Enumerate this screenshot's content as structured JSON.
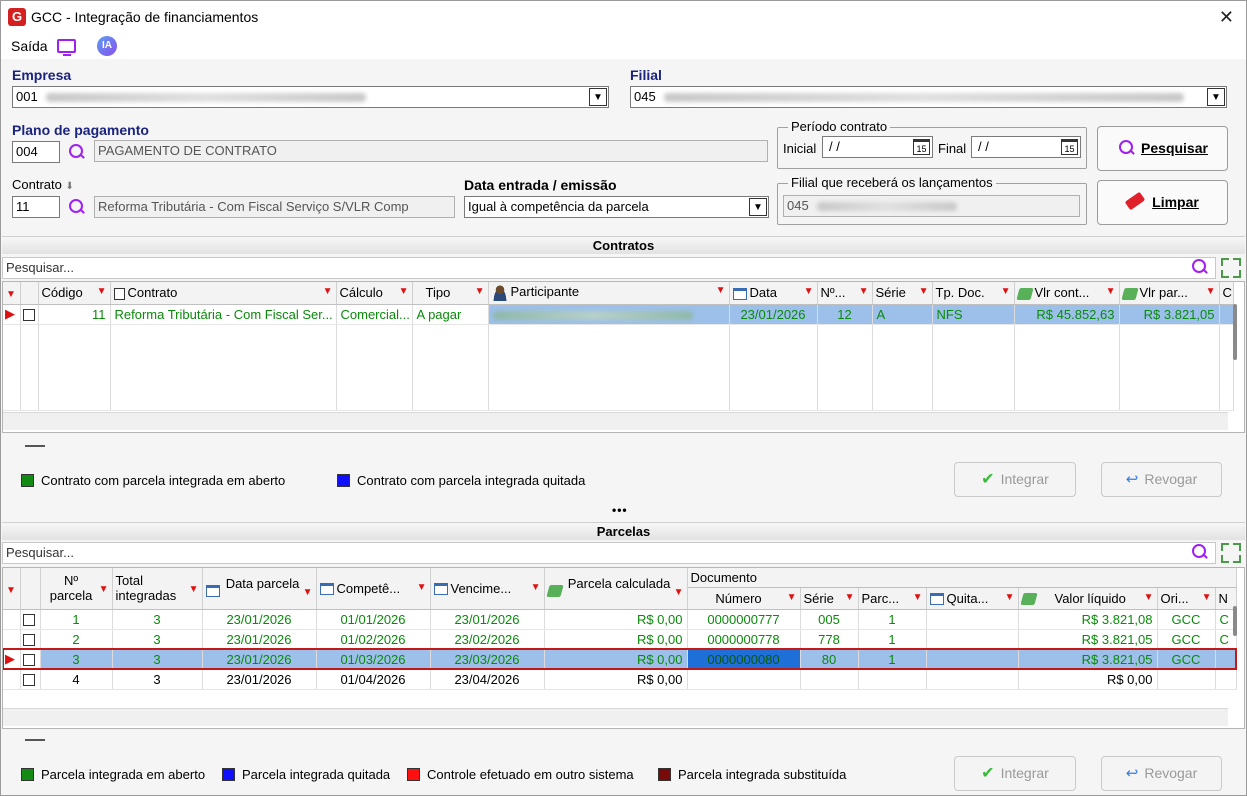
{
  "window": {
    "title": "GCC - Integração de financiamentos",
    "logo": "G",
    "close": "✕"
  },
  "menu": {
    "saida": "Saída",
    "ia": "IA"
  },
  "empresa": {
    "label": "Empresa",
    "code": "001"
  },
  "filial": {
    "label": "Filial",
    "code": "045"
  },
  "plano": {
    "label": "Plano de pagamento",
    "code": "004",
    "desc": "PAGAMENTO DE CONTRATO"
  },
  "periodo": {
    "label": "Período contrato",
    "inicial_label": "Inicial",
    "inicial_value": "/ /",
    "final_label": "Final",
    "final_value": "/ /",
    "cal": "15"
  },
  "contrato": {
    "label": "Contrato",
    "code": "11",
    "desc": "Reforma Tributária - Com Fiscal Serviço S/VLR Comp"
  },
  "data_entrada": {
    "label": "Data entrada / emissão",
    "value": "Igual à competência da parcela"
  },
  "filial_receb": {
    "label": "Filial que receberá os lançamentos",
    "code": "045"
  },
  "buttons": {
    "pesquisar": "Pesquisar",
    "limpar": "Limpar",
    "integrar": "Integrar",
    "revogar": "Revogar"
  },
  "contratos": {
    "title": "Contratos",
    "search_placeholder": "Pesquisar...",
    "headers": [
      "Código",
      "Contrato",
      "Cálculo",
      "Tipo",
      "Participante",
      "Data",
      "Nº...",
      "Série",
      "Tp. Doc.",
      "Vlr cont...",
      "Vlr par...",
      "C"
    ],
    "rows": [
      {
        "codigo": "11",
        "contrato": "Reforma Tributária - Com Fiscal Ser...",
        "calculo": "Comercial...",
        "tipo": "A pagar",
        "data": "23/01/2026",
        "num": "12",
        "serie": "A",
        "tpdoc": "NFS",
        "vlr_cont": "R$ 45.852,63",
        "vlr_par": "R$ 3.821,05"
      }
    ],
    "legend": [
      "Contrato com parcela integrada em aberto",
      "Contrato com parcela integrada quitada"
    ],
    "legend_colors": [
      "#138a13",
      "#1010ff"
    ]
  },
  "splitter": "•••",
  "parcelas": {
    "title": "Parcelas",
    "search_placeholder": "Pesquisar...",
    "headers": {
      "nparcela": "Nº parcela",
      "total": "Total integradas",
      "data": "Data parcela",
      "comp": "Competê...",
      "venc": "Vencime...",
      "calc": "Parcela calculada",
      "documento": "Documento",
      "numero": "Número",
      "serie": "Série",
      "parc": "Parc...",
      "quita": "Quita...",
      "valor": "Valor líquido",
      "ori": "Ori...",
      "n": "N"
    },
    "rows": [
      {
        "n": "1",
        "total": "3",
        "data": "23/01/2026",
        "comp": "01/01/2026",
        "venc": "23/01/2026",
        "calc": "R$ 0,00",
        "numero": "0000000777",
        "serie": "005",
        "parc": "1",
        "valor": "R$ 3.821,08",
        "ori": "GCC",
        "x": "C"
      },
      {
        "n": "2",
        "total": "3",
        "data": "23/01/2026",
        "comp": "01/02/2026",
        "venc": "23/02/2026",
        "calc": "R$ 0,00",
        "numero": "0000000778",
        "serie": "778",
        "parc": "1",
        "valor": "R$ 3.821,05",
        "ori": "GCC",
        "x": "C"
      },
      {
        "n": "3",
        "total": "3",
        "data": "23/01/2026",
        "comp": "01/03/2026",
        "venc": "23/03/2026",
        "calc": "R$ 0,00",
        "numero": "0000000080",
        "serie": "80",
        "parc": "1",
        "valor": "R$ 3.821,05",
        "ori": "GCC",
        "x": ""
      },
      {
        "n": "4",
        "total": "3",
        "data": "23/01/2026",
        "comp": "01/04/2026",
        "venc": "23/04/2026",
        "calc": "R$ 0,00",
        "numero": "",
        "serie": "",
        "parc": "",
        "valor": "R$ 0,00",
        "ori": "",
        "x": ""
      }
    ],
    "legend": [
      "Parcela integrada em aberto",
      "Parcela integrada quitada",
      "Controle efetuado em outro sistema",
      "Parcela integrada substituída"
    ],
    "legend_colors": [
      "#138a13",
      "#1010ff",
      "#ff1010",
      "#7a0a0a"
    ]
  }
}
